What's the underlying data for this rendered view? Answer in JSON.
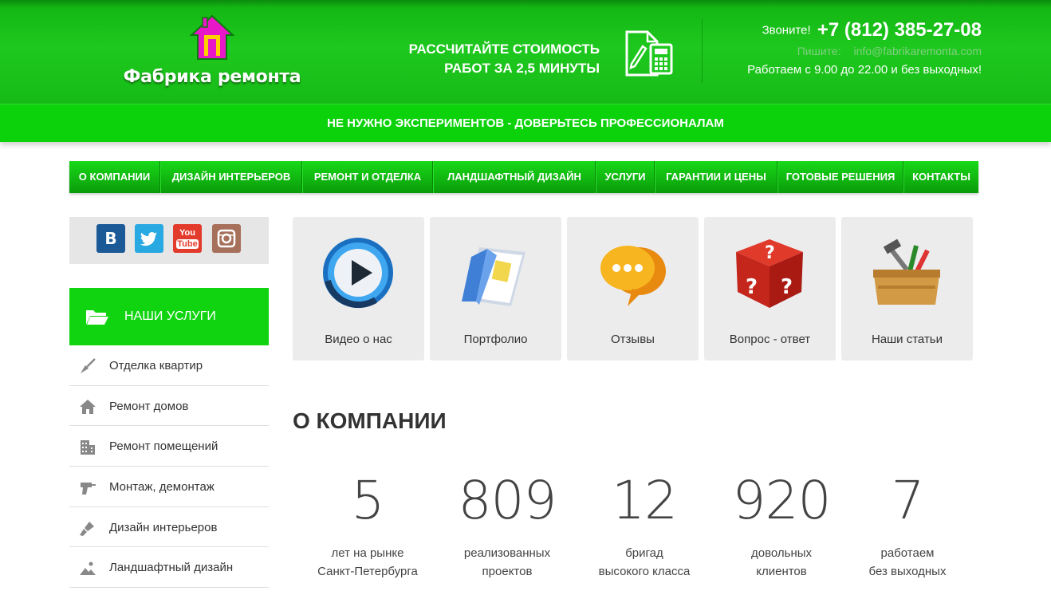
{
  "header": {
    "logo_text": "Фабрика ремонта",
    "calc_line1": "РАССЧИТАЙТЕ СТОИМОСТЬ",
    "calc_line2": "РАБОТ ЗА 2,5 МИНУТЫ",
    "call_label": "Звоните!",
    "phone": "+7 (812) 385-27-08",
    "write_label": "Пишите:",
    "email": "info@fabrikaremonta.com",
    "hours": "Работаем с 9.00 до 22.00 и без выходных!"
  },
  "slogan": "НЕ НУЖНО ЭКСПЕРИМЕНТОВ - ДОВЕРЬТЕСЬ ПРОФЕССИОНАЛАМ",
  "nav": {
    "items": [
      {
        "label": "О КОМПАНИИ"
      },
      {
        "label": "ДИЗАЙН ИНТЕРЬЕРОВ"
      },
      {
        "label": "РЕМОНТ И ОТДЕЛКА"
      },
      {
        "label": "ЛАНДШАФТНЫЙ ДИЗАЙН"
      },
      {
        "label": "УСЛУГИ"
      },
      {
        "label": "ГАРАНТИИ И ЦЕНЫ"
      },
      {
        "label": "ГОТОВЫЕ РЕШЕНИЯ"
      },
      {
        "label": "КОНТАКТЫ"
      }
    ]
  },
  "social": {
    "vk": "B",
    "youtube_top": "You",
    "youtube_bottom": "Tube"
  },
  "sidebar": {
    "services_title": "НАШИ УСЛУГИ",
    "items": [
      {
        "label": "Отделка квартир",
        "icon": "trowel-icon"
      },
      {
        "label": "Ремонт домов",
        "icon": "house-icon"
      },
      {
        "label": "Ремонт помещений",
        "icon": "building-icon"
      },
      {
        "label": "Монтаж, демонтаж",
        "icon": "drill-icon"
      },
      {
        "label": "Дизайн интерьеров",
        "icon": "brush-icon"
      },
      {
        "label": "Ландшафтный дизайн",
        "icon": "landscape-icon"
      }
    ]
  },
  "tiles": [
    {
      "label": "Видео о нас",
      "icon": "video-play-icon"
    },
    {
      "label": "Портфолио",
      "icon": "portfolio-folder-icon"
    },
    {
      "label": "Отзывы",
      "icon": "reviews-bubble-icon"
    },
    {
      "label": "Вопрос - ответ",
      "icon": "question-dice-icon"
    },
    {
      "label": "Наши статьи",
      "icon": "toolbox-icon"
    }
  ],
  "about": {
    "title": "О КОМПАНИИ",
    "stats": [
      {
        "value": "5",
        "line1": "лет на рынке",
        "line2": "Санкт-Петербурга"
      },
      {
        "value": "809",
        "line1": "реализованных",
        "line2": "проектов"
      },
      {
        "value": "12",
        "line1": "бригад",
        "line2": "высокого класса"
      },
      {
        "value": "920",
        "line1": "довольных",
        "line2": "клиентов"
      },
      {
        "value": "7",
        "line1": "работаем",
        "line2": "без выходных"
      }
    ]
  },
  "colors": {
    "brand_green": "#1ec81e",
    "slogan_green": "#0bd20b",
    "logo_magenta": "#e817c8"
  }
}
